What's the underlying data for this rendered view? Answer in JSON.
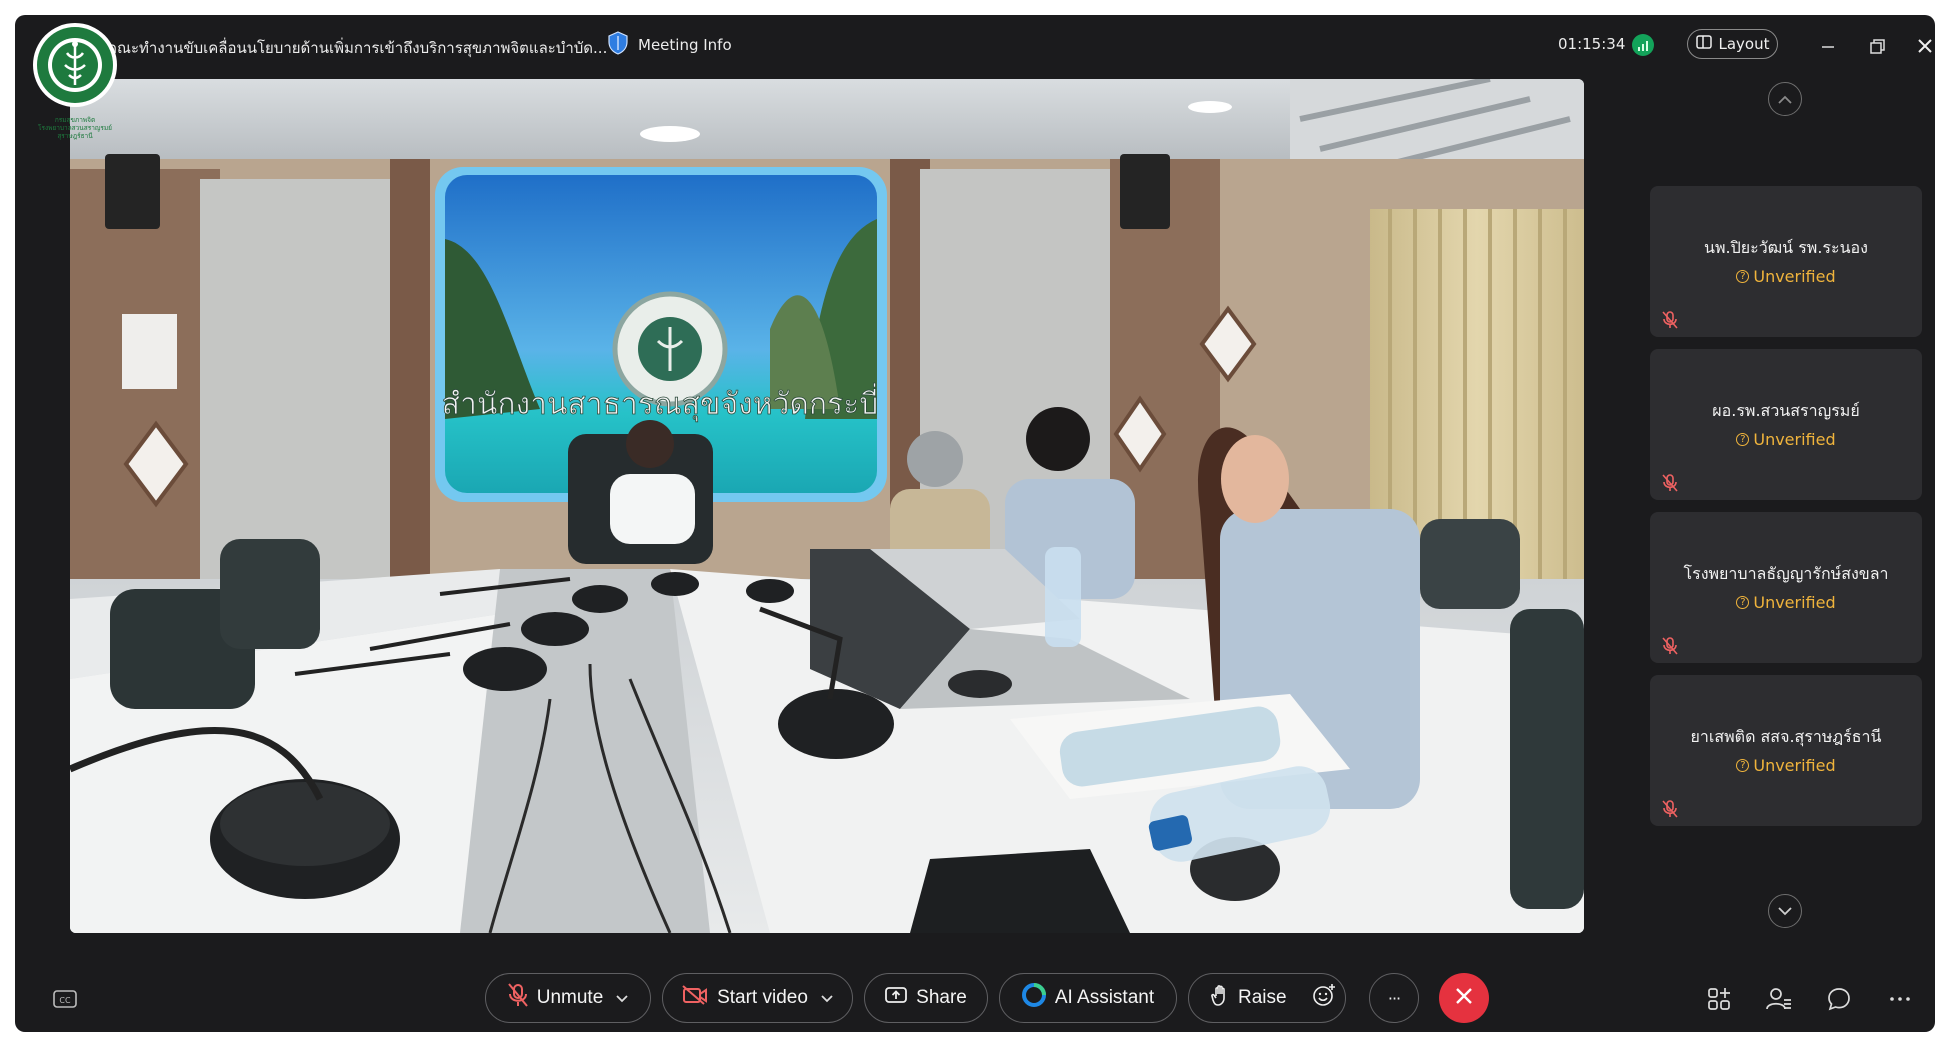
{
  "titlebar": {
    "meeting_title": "คณะทำงานขับเคลื่อนนโยบายด้านเพิ่มการเข้าถึงบริการสุขภาพจิตและบำบัด...",
    "meeting_info_label": "Meeting Info",
    "timer": "01:15:34",
    "layout_label": "Layout"
  },
  "logo": {
    "caption_line1": "กรมสุขภาพจิต",
    "caption_line2": "โรงพยาบาลสวนสราญรมย์",
    "caption_line3": "สุราษฎร์ธานี"
  },
  "video": {
    "wall_sign": "สำนักงานสาธารณสุขจังหวัดกระบี่"
  },
  "participants": [
    {
      "name": "นพ.ปิยะวัฒน์ รพ.ระนอง",
      "status": "Unverified",
      "muted": true
    },
    {
      "name": "ผอ.รพ.สวนสราญรมย์",
      "status": "Unverified",
      "muted": true
    },
    {
      "name": "โรงพยาบาลธัญญารักษ์สงขลา",
      "status": "Unverified",
      "muted": true
    },
    {
      "name": "ยาเสพติด สสจ.สุราษฎร์ธานี",
      "status": "Unverified",
      "muted": true
    }
  ],
  "controls": {
    "unmute_label": "Unmute",
    "start_video_label": "Start video",
    "share_label": "Share",
    "ai_assistant_label": "AI Assistant",
    "raise_label": "Raise",
    "more_label": "···"
  },
  "colors": {
    "accent_status": "#f0b43c",
    "end_call": "#e5323f",
    "mic_muted": "#ef6262",
    "connection": "#13a35a"
  },
  "icons": [
    "captions-icon",
    "mic-off-icon",
    "video-off-icon",
    "share-icon",
    "ai-assistant-icon",
    "raise-hand-icon",
    "reaction-icon",
    "more-icon",
    "end-call-icon",
    "apps-icon",
    "participants-icon",
    "chat-icon",
    "overflow-icon"
  ]
}
